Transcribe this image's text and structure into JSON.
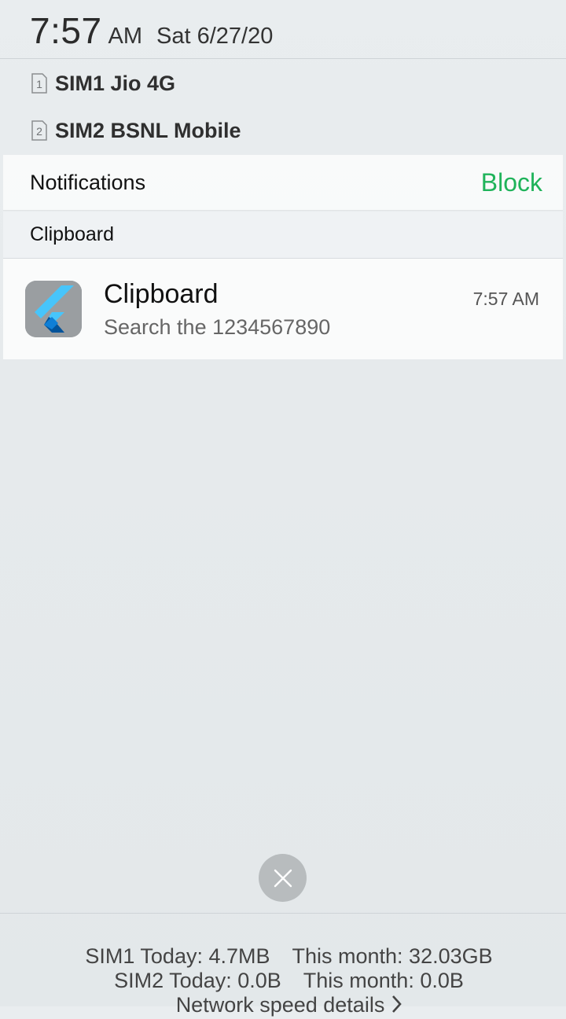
{
  "status": {
    "time": "7:57",
    "ampm": "AM",
    "date": "Sat 6/27/20"
  },
  "sims": [
    {
      "index_label": "1",
      "name": "SIM1 Jio 4G"
    },
    {
      "index_label": "2",
      "name": "SIM2 BSNL Mobile"
    }
  ],
  "panel": {
    "title": "Notifications",
    "block_label": "Block",
    "section_label": "Clipboard",
    "notification": {
      "app_icon": "flutter-app-icon",
      "title": "Clipboard",
      "time": "7:57 AM",
      "body": "Search the 1234567890"
    }
  },
  "close_icon": "close-icon",
  "footer": {
    "sim1_today": "SIM1 Today: 4.7MB",
    "sim1_month": "This month: 32.03GB",
    "sim2_today": "SIM2 Today: 0.0B",
    "sim2_month": "This month: 0.0B",
    "network_link": "Network speed details"
  },
  "colors": {
    "accent_block": "#1fb35a",
    "flutter_light": "#47c5fb",
    "flutter_dark": "#02539a"
  }
}
